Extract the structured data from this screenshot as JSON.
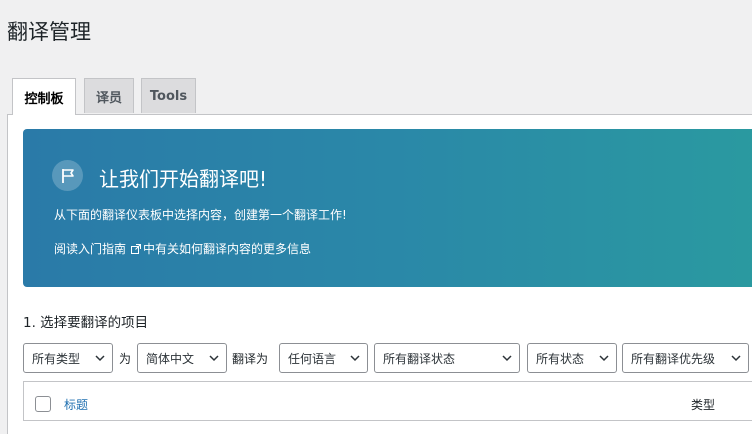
{
  "page": {
    "title": "翻译管理"
  },
  "tabs": [
    {
      "label": "控制板",
      "active": true
    },
    {
      "label": "译员",
      "active": false
    },
    {
      "label": "Tools",
      "active": false
    }
  ],
  "banner": {
    "icon": "flag-icon",
    "title": "让我们开始翻译吧!",
    "description": "从下面的翻译仪表板中选择内容，创建第一个翻译工作!",
    "link_text": "阅读入门指南",
    "link_suffix": "中有关如何翻译内容的更多信息",
    "gradient_start": "#2a7aa8",
    "gradient_end": "#2a9aa0"
  },
  "section": {
    "title": "1. 选择要翻译的项目"
  },
  "filters": {
    "type": "所有类型",
    "for_label": "为",
    "source_language": "简体中文",
    "translate_to_label": "翻译为",
    "target_language": "任何语言",
    "translation_status": "所有翻译状态",
    "status": "所有状态",
    "priority": "所有翻译优先级"
  },
  "table": {
    "columns": [
      "标题",
      "类型"
    ]
  },
  "colors": {
    "background": "#f0f0f1",
    "link": "#2271b1",
    "border": "#c3c4c7"
  }
}
